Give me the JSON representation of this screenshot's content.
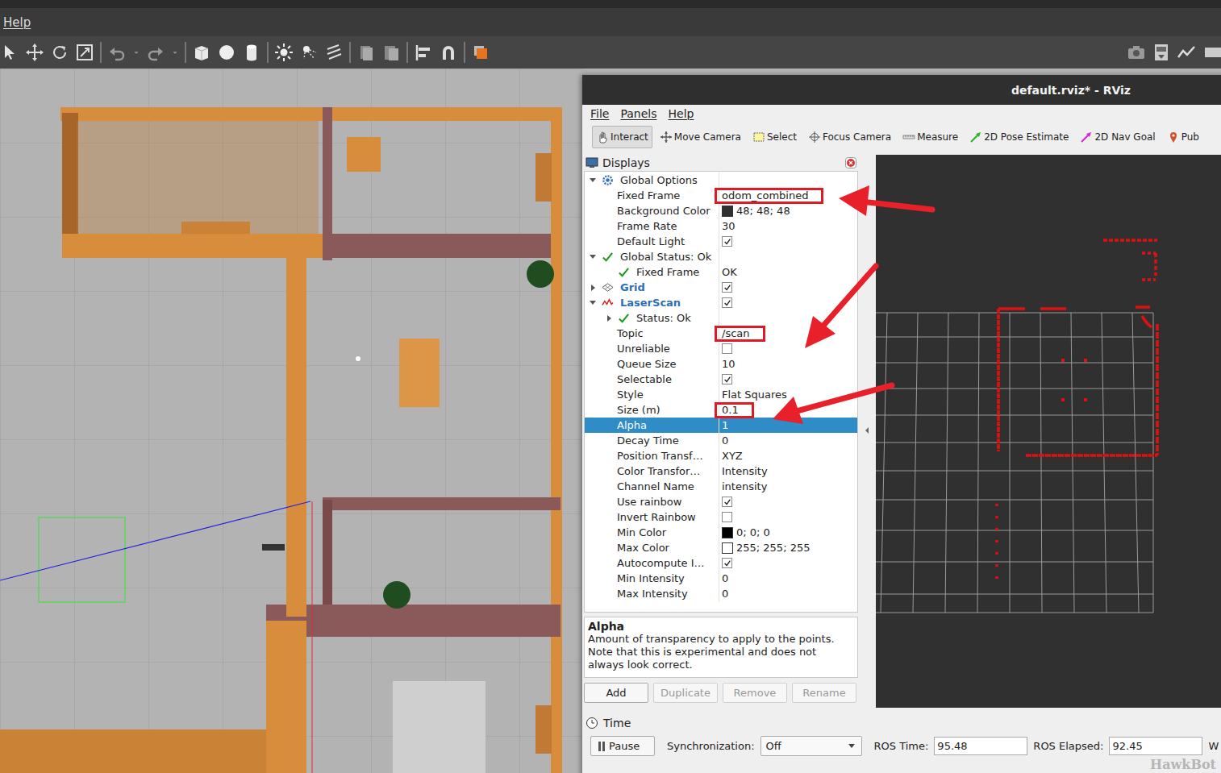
{
  "gazebo": {
    "menu": [
      "Help"
    ]
  },
  "rviz": {
    "window": {
      "title": "default.rviz* - RViz"
    },
    "menu": [
      "File",
      "Panels",
      "Help"
    ],
    "tools": [
      {
        "label": "Interact",
        "selected": true
      },
      {
        "label": "Move Camera",
        "selected": false
      },
      {
        "label": "Select",
        "selected": false
      },
      {
        "label": "Focus Camera",
        "selected": false
      },
      {
        "label": "Measure",
        "selected": false
      },
      {
        "label": "2D Pose Estimate",
        "selected": false
      },
      {
        "label": "2D Nav Goal",
        "selected": false
      },
      {
        "label": "Pub",
        "selected": false
      }
    ],
    "displays": {
      "title": "Displays",
      "rows": [
        {
          "label": "Global Options",
          "value": "",
          "depth": 0,
          "kind": "options",
          "branch": true,
          "expanded": true,
          "selected": false,
          "highlighted": false
        },
        {
          "label": "Fixed Frame",
          "value": "odom_combined",
          "depth": 1,
          "kind": "text",
          "branch": false,
          "selected": false,
          "highlighted": true
        },
        {
          "label": "Background Color",
          "value": "48; 48; 48",
          "depth": 1,
          "kind": "color",
          "branch": false,
          "selected": false,
          "highlighted": false
        },
        {
          "label": "Frame Rate",
          "value": "30",
          "depth": 1,
          "kind": "text",
          "branch": false,
          "selected": false,
          "highlighted": false
        },
        {
          "label": "Default Light",
          "value": "",
          "depth": 1,
          "kind": "checkbox",
          "branch": false,
          "checked": true,
          "selected": false,
          "highlighted": false
        },
        {
          "label": "Global Status: Ok",
          "value": "",
          "depth": 0,
          "kind": "status",
          "branch": true,
          "expanded": true,
          "selected": false,
          "highlighted": false
        },
        {
          "label": "Fixed Frame",
          "value": "OK",
          "depth": 1,
          "kind": "status",
          "branch": false,
          "selected": false,
          "highlighted": false
        },
        {
          "label": "Grid",
          "value": "",
          "depth": 0,
          "kind": "display",
          "branch": true,
          "expanded": false,
          "checked": true,
          "selected": false,
          "highlighted": false
        },
        {
          "label": "LaserScan",
          "value": "",
          "depth": 0,
          "kind": "display",
          "branch": true,
          "expanded": true,
          "checked": true,
          "selected": false,
          "highlighted": false
        },
        {
          "label": "Status: Ok",
          "value": "",
          "depth": 1,
          "kind": "status",
          "branch": true,
          "expanded": false,
          "selected": false,
          "highlighted": false
        },
        {
          "label": "Topic",
          "value": "/scan",
          "depth": 1,
          "kind": "text",
          "branch": false,
          "selected": false,
          "highlighted": true
        },
        {
          "label": "Unreliable",
          "value": "",
          "depth": 1,
          "kind": "checkbox",
          "branch": false,
          "checked": false,
          "selected": false,
          "highlighted": false
        },
        {
          "label": "Queue Size",
          "value": "10",
          "depth": 1,
          "kind": "text",
          "branch": false,
          "selected": false,
          "highlighted": false
        },
        {
          "label": "Selectable",
          "value": "",
          "depth": 1,
          "kind": "checkbox",
          "branch": false,
          "checked": true,
          "selected": false,
          "highlighted": false
        },
        {
          "label": "Style",
          "value": "Flat Squares",
          "depth": 1,
          "kind": "text",
          "branch": false,
          "selected": false,
          "highlighted": false
        },
        {
          "label": "Size (m)",
          "value": "0.1",
          "depth": 1,
          "kind": "text",
          "branch": false,
          "selected": false,
          "highlighted": true
        },
        {
          "label": "Alpha",
          "value": "1",
          "depth": 1,
          "kind": "text",
          "branch": false,
          "selected": true,
          "highlighted": false
        },
        {
          "label": "Decay Time",
          "value": "0",
          "depth": 1,
          "kind": "text",
          "branch": false,
          "selected": false,
          "highlighted": false
        },
        {
          "label": "Position Transf…",
          "value": "XYZ",
          "depth": 1,
          "kind": "text",
          "branch": false,
          "selected": false,
          "highlighted": false
        },
        {
          "label": "Color Transfor…",
          "value": "Intensity",
          "depth": 1,
          "kind": "text",
          "branch": false,
          "selected": false,
          "highlighted": false
        },
        {
          "label": "Channel Name",
          "value": "intensity",
          "depth": 1,
          "kind": "text",
          "branch": false,
          "selected": false,
          "highlighted": false
        },
        {
          "label": "Use rainbow",
          "value": "",
          "depth": 1,
          "kind": "checkbox",
          "branch": false,
          "checked": true,
          "selected": false,
          "highlighted": false
        },
        {
          "label": "Invert Rainbow",
          "value": "",
          "depth": 1,
          "kind": "checkbox",
          "branch": false,
          "checked": false,
          "selected": false,
          "highlighted": false
        },
        {
          "label": "Min Color",
          "value": "0; 0; 0",
          "depth": 1,
          "kind": "color",
          "branch": false,
          "selected": false,
          "highlighted": false
        },
        {
          "label": "Max Color",
          "value": "255; 255; 255",
          "depth": 1,
          "kind": "color",
          "branch": false,
          "selected": false,
          "highlighted": false
        },
        {
          "label": "Autocompute I…",
          "value": "",
          "depth": 1,
          "kind": "checkbox",
          "branch": false,
          "checked": true,
          "selected": false,
          "highlighted": false
        },
        {
          "label": "Min Intensity",
          "value": "0",
          "depth": 1,
          "kind": "text",
          "branch": false,
          "selected": false,
          "highlighted": false
        },
        {
          "label": "Max Intensity",
          "value": "0",
          "depth": 1,
          "kind": "text",
          "branch": false,
          "selected": false,
          "highlighted": false
        }
      ],
      "description": {
        "title": "Alpha",
        "text": "Amount of transparency to apply to the points. Note that this is experimental and does not always look correct."
      },
      "buttons": [
        {
          "label": "Add",
          "disabled": false
        },
        {
          "label": "Duplicate",
          "disabled": true
        },
        {
          "label": "Remove",
          "disabled": true
        },
        {
          "label": "Rename",
          "disabled": true
        }
      ]
    },
    "time": {
      "title": "Time",
      "pause": "Pause",
      "sync_label": "Synchronization:",
      "sync_value": "Off",
      "ros_time_label": "ROS Time:",
      "ros_time": "95.48",
      "ros_elapsed_label": "ROS Elapsed:",
      "ros_elapsed": "92.45",
      "wall_label": "W"
    }
  },
  "watermark": "HawkBot"
}
